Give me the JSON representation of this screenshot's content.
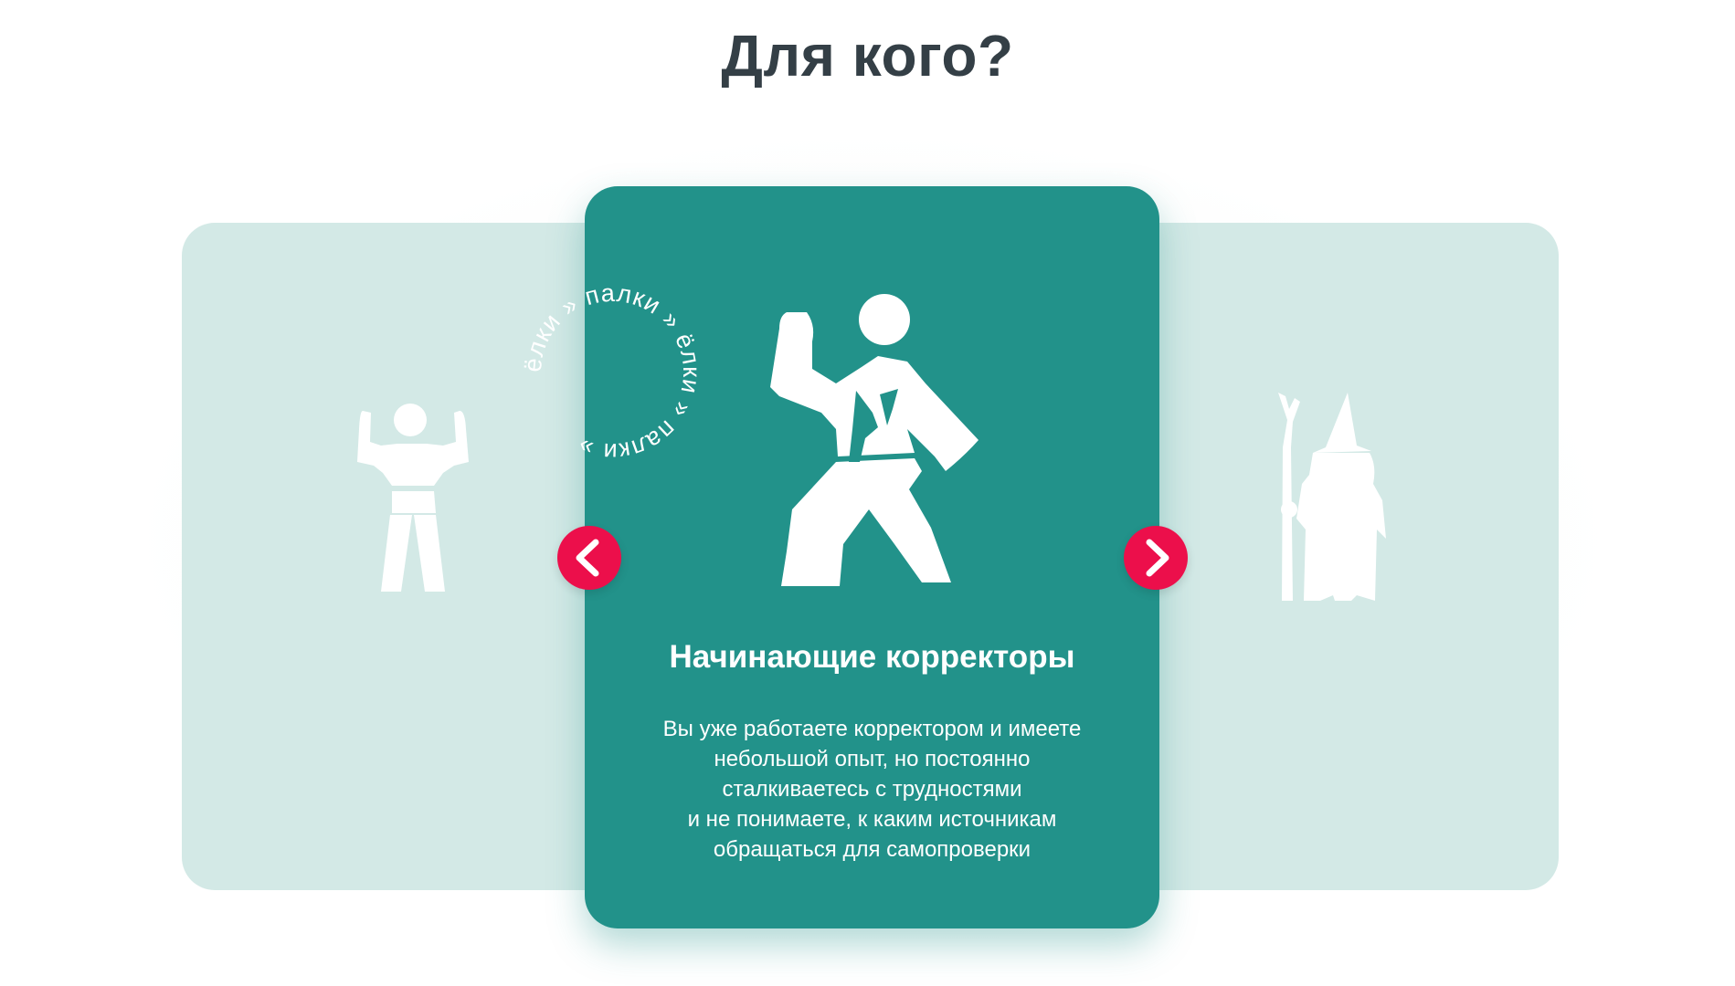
{
  "section": {
    "title": "Для кого?"
  },
  "card": {
    "title": "Начинающие корректоры",
    "description_lines": [
      "Вы уже работаете корректором и имеете",
      "небольшой опыт, но постоянно",
      "сталкиваетесь с трудностями",
      "и не понимаете, к каким источникам",
      "обращаться для самопроверки"
    ],
    "icon": "karate-person-icon"
  },
  "stamp": {
    "circular_text": "ёлки » палки » ёлки » палки »"
  },
  "side_cards": {
    "left_icon": "strong-person-icon",
    "right_icon": "wizard-icon"
  },
  "navigation": {
    "prev_icon": "chevron-left-icon",
    "next_icon": "chevron-right-icon"
  },
  "colors": {
    "accent": "#ec0f4b",
    "card_bg": "#22928a",
    "side_bg": "#d3e9e6",
    "title": "#343f46"
  }
}
